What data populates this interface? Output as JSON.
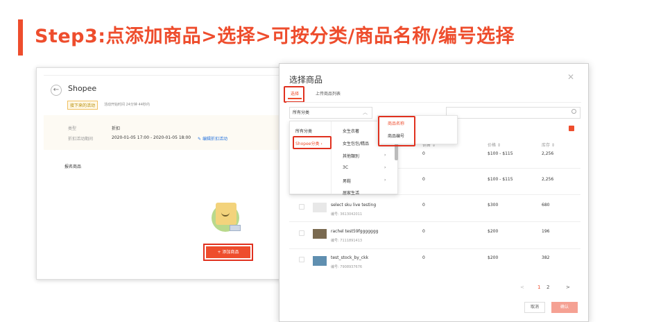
{
  "header": {
    "title": "Step3:点添加商品>选择>可按分类/商品名称/编号选择"
  },
  "background_window": {
    "title": "Shopee",
    "status": "接下来的活动",
    "status_desc": "活动开始时间 24分钟 44秒内",
    "type_label": "类型",
    "type_value": "折扣",
    "period_label": "折扣活动期间",
    "period_value": "2020-01-05 17:00 - 2020-01-05 18:00",
    "edit_link": "编辑折扣活动",
    "section": "报名商品",
    "add_button": "+ 添加商品"
  },
  "modal": {
    "title": "选择商品",
    "tabs": [
      "选择",
      "上传商品列表"
    ],
    "category_select": "所有分类",
    "search_by_options": [
      "商品名称",
      "商品编号"
    ],
    "category_col1": [
      "所有分类",
      "Shopee分类"
    ],
    "category_col2": [
      "女生衣著",
      "女生包包/精品",
      "其他類別",
      "3C",
      "男鞋",
      "居家生活"
    ],
    "columns": {
      "sold": "销售 ⇕",
      "price": "价格 ⇕",
      "stock": "库存 ⇕"
    },
    "rows": [
      {
        "name": "",
        "code": "",
        "sold": "0",
        "price": "$100 - $115",
        "stock": "2,256"
      },
      {
        "name": "",
        "code": "",
        "sold": "0",
        "price": "$100 - $115",
        "stock": "2,256"
      },
      {
        "name": "select sku live testing",
        "code": "编号: 3613042011",
        "sold": "0",
        "price": "$300",
        "stock": "680"
      },
      {
        "name": "rachel test59fggggggg",
        "code": "编号: 7111891413",
        "sold": "0",
        "price": "$200",
        "stock": "196"
      },
      {
        "name": "test_stock_by_ckk",
        "code": "编号: 7908937676",
        "sold": "0",
        "price": "$200",
        "stock": "382"
      }
    ],
    "pager": {
      "prev": "<",
      "page1": "1",
      "page2": "2",
      "next": ">"
    },
    "cancel": "取消",
    "confirm": "确认"
  },
  "colors": {
    "accent": "#ee4d2d",
    "highlight_box": "#e0301e"
  }
}
